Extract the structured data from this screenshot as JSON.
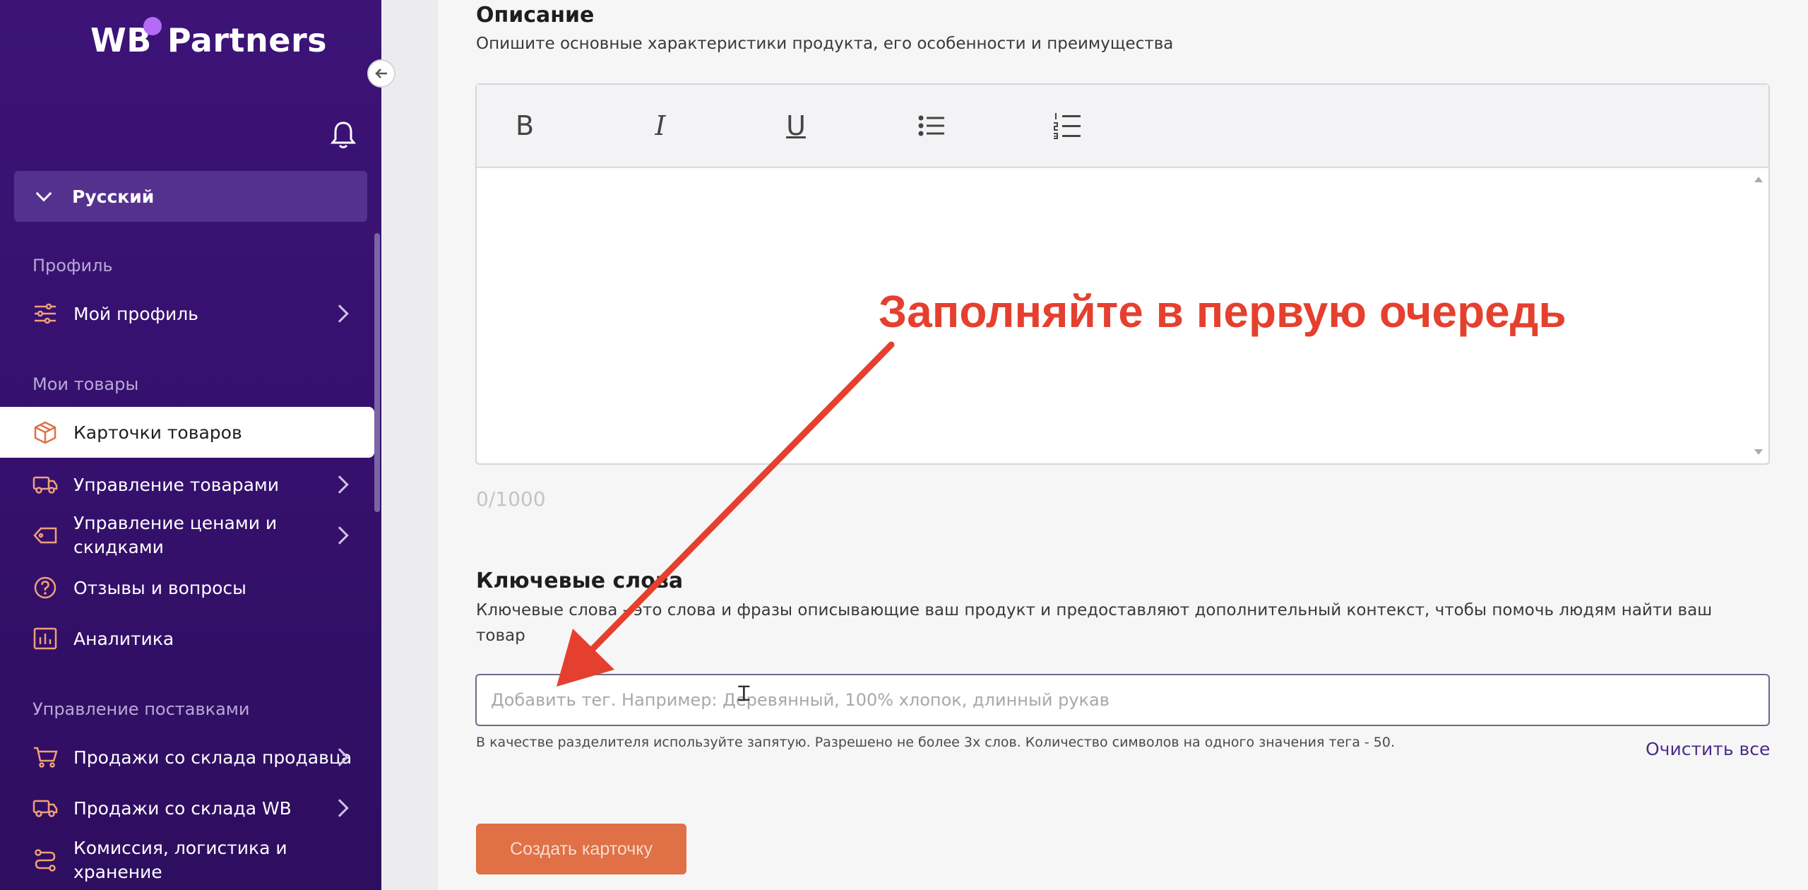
{
  "brand": {
    "name_part1": "WB",
    "name_part2": "Partners"
  },
  "sidebar": {
    "language": "Русский",
    "sections": {
      "profile": "Профиль",
      "my_goods": "Мои товары",
      "supply_management": "Управление поставками"
    },
    "items": {
      "my_profile": "Мой профиль",
      "product_cards": "Карточки товаров",
      "goods_management": "Управление товарами",
      "prices_discounts_l1": "Управление ценами и",
      "prices_discounts_l2": "скидками",
      "reviews": "Отзывы и вопросы",
      "analytics": "Аналитика",
      "seller_warehouse_sales": "Продажи со склада продавца",
      "wb_warehouse_sales": "Продажи со склада WB",
      "commission_l1": "Комиссия, логистика и",
      "commission_l2": "хранение"
    }
  },
  "description": {
    "title": "Описание",
    "subtitle": "Опишите основные характеристики продукта, его особенности и преимущества",
    "counter": "0/1000",
    "toolbar": {
      "bold": "B",
      "italic": "I",
      "underline": "U"
    }
  },
  "keywords": {
    "title": "Ключевые слова",
    "subtitle": "Ключевые слова - это слова и фразы описывающие ваш продукт и предоставляют дополнительный контекст, чтобы помочь людям найти ваш товар",
    "placeholder": "Добавить тег. Например: Деревянный, 100% хлопок, длинный рукав",
    "hint": "В качестве разделителя используйте запятую. Разрешено не более 3х слов. Количество символов на одного значения тега - 50.",
    "clear_all": "Очистить все"
  },
  "create_button": "Создать карточку",
  "annotation": "Заполняйте в первую очередь",
  "colors": {
    "sidebar_bg": "#3d1377",
    "accent": "#e07046",
    "annotation": "#e5402f",
    "link": "#4b2c87"
  }
}
